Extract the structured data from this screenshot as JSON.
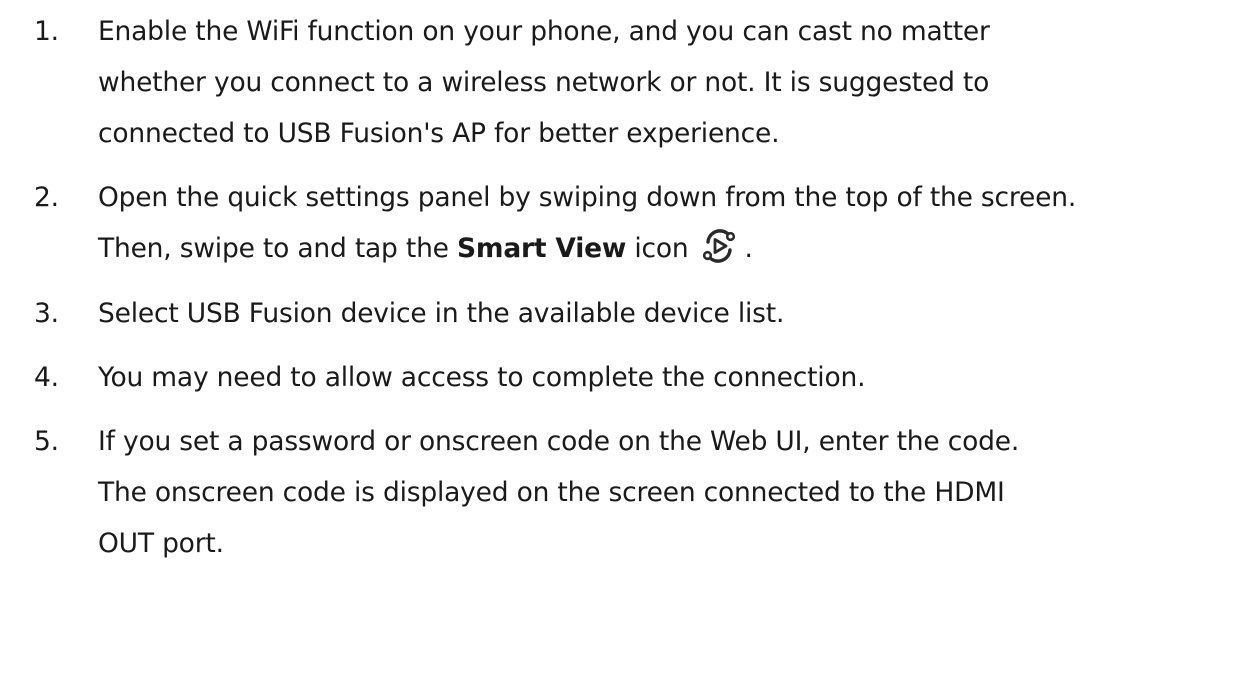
{
  "steps": [
    {
      "number": "1.",
      "lines": [
        "Enable the WiFi function on your phone, and you can cast no matter",
        "whether you connect to a wireless network or not. It is suggested to",
        "connected to USB Fusion's AP for better experience."
      ]
    },
    {
      "number": "2.",
      "line1": "Open the quick settings panel by swiping down from the top of the screen.",
      "line2_before": "Then, swipe to and tap the ",
      "line2_bold": "Smart View",
      "line2_after_bold": " icon",
      "line2_end": ".",
      "icon": "smart-view-icon"
    },
    {
      "number": "3.",
      "text": "Select USB Fusion device in the available device list."
    },
    {
      "number": "4.",
      "text": "You may need to allow access to complete the connection."
    },
    {
      "number": "5.",
      "lines": [
        "If you set a password or onscreen code on the Web UI, enter the code.",
        "The onscreen code is displayed on the screen connected to the HDMI",
        "OUT port."
      ]
    }
  ]
}
